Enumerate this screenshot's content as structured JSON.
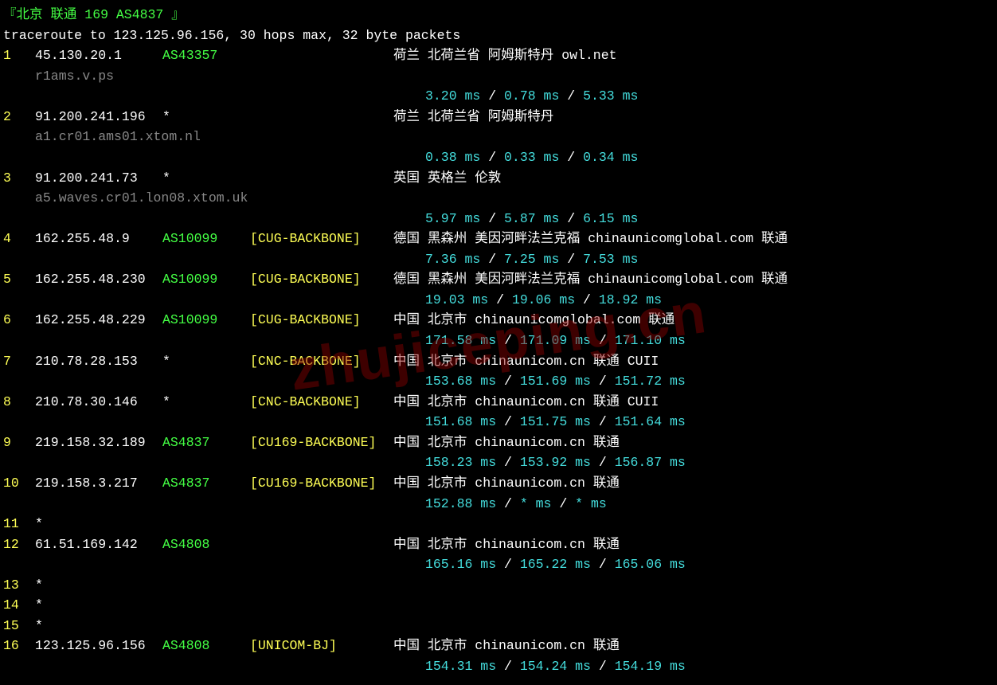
{
  "title": "『北京 联通 169 AS4837 』",
  "trace_line": "traceroute to 123.125.96.156, 30 hops max, 32 byte packets",
  "watermark": "zhujiceping.cn",
  "hops": [
    {
      "n": "1",
      "ip": "45.130.20.1",
      "asn": "AS43357",
      "asn_star": false,
      "tag": "",
      "info": "荷兰 北荷兰省 阿姆斯特丹  owl.net",
      "host": "r1ams.v.ps",
      "lat": [
        "3.20 ms",
        "0.78 ms",
        "5.33 ms"
      ]
    },
    {
      "n": "2",
      "ip": "91.200.241.196",
      "asn": "*",
      "asn_star": true,
      "tag": "",
      "info": "荷兰 北荷兰省 阿姆斯特丹",
      "host": "a1.cr01.ams01.xtom.nl",
      "lat": [
        "0.38 ms",
        "0.33 ms",
        "0.34 ms"
      ]
    },
    {
      "n": "3",
      "ip": "91.200.241.73",
      "asn": "*",
      "asn_star": true,
      "tag": "",
      "info": "英国 英格兰 伦敦",
      "host": "a5.waves.cr01.lon08.xtom.uk",
      "lat": [
        "5.97 ms",
        "5.87 ms",
        "6.15 ms"
      ]
    },
    {
      "n": "4",
      "ip": "162.255.48.9",
      "asn": "AS10099",
      "asn_star": false,
      "tag": "[CUG-BACKBONE]",
      "info": "德国 黑森州 美因河畔法兰克福  chinaunicomglobal.com  联通",
      "host": "",
      "lat": [
        "7.36 ms",
        "7.25 ms",
        "7.53 ms"
      ]
    },
    {
      "n": "5",
      "ip": "162.255.48.230",
      "asn": "AS10099",
      "asn_star": false,
      "tag": "[CUG-BACKBONE]",
      "info": "德国 黑森州 美因河畔法兰克福  chinaunicomglobal.com  联通",
      "host": "",
      "lat": [
        "19.03 ms",
        "19.06 ms",
        "18.92 ms"
      ]
    },
    {
      "n": "6",
      "ip": "162.255.48.229",
      "asn": "AS10099",
      "asn_star": false,
      "tag": "[CUG-BACKBONE]",
      "info": "中国 北京市  chinaunicomglobal.com  联通",
      "host": "",
      "lat": [
        "171.58 ms",
        "171.09 ms",
        "171.10 ms"
      ]
    },
    {
      "n": "7",
      "ip": "210.78.28.153",
      "asn": "*",
      "asn_star": true,
      "tag": "[CNC-BACKBONE]",
      "info": "中国 北京市  chinaunicom.cn  联通 CUII",
      "host": "",
      "lat": [
        "153.68 ms",
        "151.69 ms",
        "151.72 ms"
      ]
    },
    {
      "n": "8",
      "ip": "210.78.30.146",
      "asn": "*",
      "asn_star": true,
      "tag": "[CNC-BACKBONE]",
      "info": "中国 北京市   chinaunicom.cn  联通 CUII",
      "host": "",
      "lat": [
        "151.68 ms",
        "151.75 ms",
        "151.64 ms"
      ]
    },
    {
      "n": "9",
      "ip": "219.158.32.189",
      "asn": "AS4837",
      "asn_star": false,
      "tag": "[CU169-BACKBONE]",
      "info": "中国 北京市   chinaunicom.cn  联通",
      "host": "",
      "lat": [
        "158.23 ms",
        "153.92 ms",
        "156.87 ms"
      ]
    },
    {
      "n": "10",
      "ip": "219.158.3.217",
      "asn": "AS4837",
      "asn_star": false,
      "tag": "[CU169-BACKBONE]",
      "info": "中国 北京市   chinaunicom.cn  联通",
      "host": "",
      "lat": [
        "152.88 ms",
        "* ms",
        "* ms"
      ]
    },
    {
      "n": "11",
      "ip": "*",
      "asn": "",
      "asn_star": false,
      "tag": "",
      "info": "",
      "host": "",
      "lat": []
    },
    {
      "n": "12",
      "ip": "61.51.169.142",
      "asn": "AS4808",
      "asn_star": false,
      "tag": "",
      "info": "中国 北京市   chinaunicom.cn  联通",
      "host": "",
      "lat": [
        "165.16 ms",
        "165.22 ms",
        "165.06 ms"
      ]
    },
    {
      "n": "13",
      "ip": "*",
      "asn": "",
      "asn_star": false,
      "tag": "",
      "info": "",
      "host": "",
      "lat": []
    },
    {
      "n": "14",
      "ip": "*",
      "asn": "",
      "asn_star": false,
      "tag": "",
      "info": "",
      "host": "",
      "lat": []
    },
    {
      "n": "15",
      "ip": "*",
      "asn": "",
      "asn_star": false,
      "tag": "",
      "info": "",
      "host": "",
      "lat": []
    },
    {
      "n": "16",
      "ip": "123.125.96.156",
      "asn": "AS4808",
      "asn_star": false,
      "tag": "[UNICOM-BJ]",
      "info": "中国 北京市   chinaunicom.cn  联通",
      "host": "",
      "lat": [
        "154.31 ms",
        "154.24 ms",
        "154.19 ms"
      ]
    }
  ]
}
